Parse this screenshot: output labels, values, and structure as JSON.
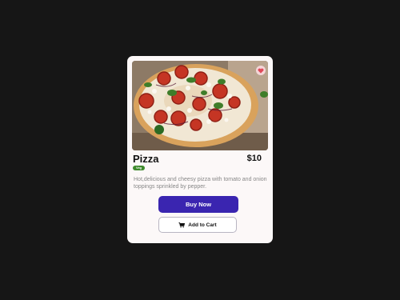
{
  "product": {
    "title": "Pizza",
    "price": "$10",
    "tag": "Veg",
    "description": "Hot,delicious and cheesy pizza with tomato and onion toppings sprinkled by pepper."
  },
  "actions": {
    "buy_label": "Buy Now",
    "cart_label": "Add to Cart"
  },
  "icons": {
    "favorite": "heart-icon",
    "cart": "cart-icon"
  },
  "colors": {
    "background": "#161616",
    "card": "#fcf8f8",
    "buy_button": "#3a25b0",
    "tag": "#3f8a2d",
    "heart": "#e04a5a"
  }
}
